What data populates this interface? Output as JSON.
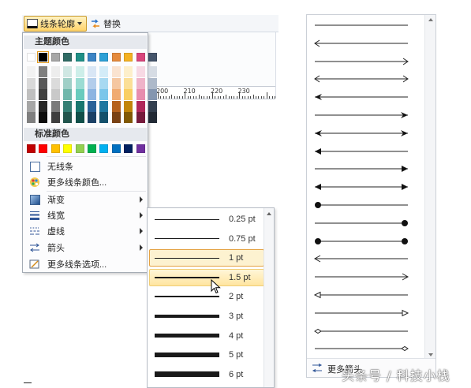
{
  "toolbar": {
    "outline_label": "线条轮廓",
    "replace_label": "替换"
  },
  "ruler": {
    "numbers": [
      "200",
      "210",
      "220",
      "230"
    ]
  },
  "color_menu": {
    "theme_title": "主题颜色",
    "standard_title": "标准颜色",
    "theme_top": [
      "#ffffff",
      "#000000",
      "#a6a6a6",
      "#2f6a64",
      "#1f8f86",
      "#3b83c4",
      "#2da0d6",
      "#e58a3c",
      "#f4b122",
      "#d9467c",
      "#44546a"
    ],
    "theme_columns": [
      [
        "#f2f2f2",
        "#d9d9d9",
        "#bfbfbf",
        "#a6a6a6",
        "#7f7f7f"
      ],
      [
        "#7f7f7f",
        "#595959",
        "#404040",
        "#262626",
        "#0d0d0d"
      ],
      [
        "#ededed",
        "#dbdbdb",
        "#c9c9c9",
        "#7b7b7b",
        "#3f3f3f"
      ],
      [
        "#cfe7e3",
        "#9fcfc7",
        "#6fb7ab",
        "#347f74",
        "#22554d"
      ],
      [
        "#cdeee9",
        "#9bdcd3",
        "#69cbbd",
        "#19776f",
        "#104f49"
      ],
      [
        "#d9e6f5",
        "#b3cdeb",
        "#8db4e1",
        "#2a6299",
        "#1c4166"
      ],
      [
        "#d3ecf8",
        "#a7d9f1",
        "#7bc6ea",
        "#1f77a0",
        "#14506b"
      ],
      [
        "#fae3d0",
        "#f5c7a1",
        "#f0ab72",
        "#b5621e",
        "#794114"
      ],
      [
        "#fdefcb",
        "#fbdf97",
        "#f9cf63",
        "#c28508",
        "#815905"
      ],
      [
        "#f7d9e4",
        "#efb3c9",
        "#e78dae",
        "#b0285a",
        "#761b3c"
      ],
      [
        "#d6dce4",
        "#adb9ca",
        "#8496b0",
        "#333f4f",
        "#222a35"
      ]
    ],
    "standard": [
      "#c00000",
      "#ff0000",
      "#ffc000",
      "#ffff00",
      "#92d050",
      "#00b050",
      "#00b0f0",
      "#0070c0",
      "#002060",
      "#7030a0"
    ],
    "items": {
      "no_line": "无线条",
      "more_colors": "更多线条颜色...",
      "gradient": "渐变",
      "weight": "线宽",
      "dashes": "虚线",
      "arrows": "箭头",
      "more_options": "更多线条选项..."
    }
  },
  "width_menu": {
    "items": [
      {
        "label": "0.25 pt",
        "weight": 0.25
      },
      {
        "label": "0.75 pt",
        "weight": 0.75
      },
      {
        "label": "1 pt",
        "weight": 1,
        "state": "checked"
      },
      {
        "label": "1.5 pt",
        "weight": 1.5,
        "state": "hover"
      },
      {
        "label": "2 pt",
        "weight": 2
      },
      {
        "label": "3 pt",
        "weight": 3
      },
      {
        "label": "4 pt",
        "weight": 4
      },
      {
        "label": "5 pt",
        "weight": 5
      },
      {
        "label": "6 pt",
        "weight": 6
      }
    ]
  },
  "arrow_panel": {
    "styles": [
      {
        "left": "none",
        "right": "none"
      },
      {
        "left": "open",
        "right": "none"
      },
      {
        "left": "none",
        "right": "open"
      },
      {
        "left": "open",
        "right": "open"
      },
      {
        "left": "stealth",
        "right": "none"
      },
      {
        "left": "none",
        "right": "stealth"
      },
      {
        "left": "stealth",
        "right": "stealth"
      },
      {
        "left": "triangle",
        "right": "none"
      },
      {
        "left": "none",
        "right": "triangle"
      },
      {
        "left": "triangle",
        "right": "triangle"
      },
      {
        "left": "dot",
        "right": "none"
      },
      {
        "left": "none",
        "right": "dot"
      },
      {
        "left": "dot",
        "right": "dot"
      },
      {
        "left": "open-thin",
        "right": "none"
      },
      {
        "left": "none",
        "right": "open-thin"
      },
      {
        "left": "hollow-triangle",
        "right": "none"
      },
      {
        "left": "none",
        "right": "hollow-triangle"
      },
      {
        "left": "hollow-diamond",
        "right": "none"
      },
      {
        "left": "none",
        "right": "hollow-diamond"
      }
    ],
    "footer_label": "更多箭头"
  },
  "watermark": "头条号 / 科技小栈"
}
